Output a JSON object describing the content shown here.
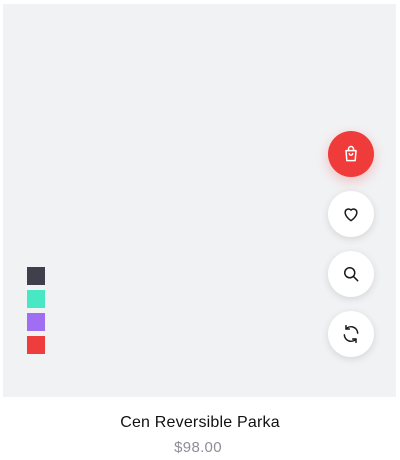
{
  "product": {
    "title": "Cen Reversible Parka",
    "price": "$98.00"
  },
  "swatches": [
    {
      "color": "#403f4c",
      "name": "dark-gray"
    },
    {
      "color": "#48e8c4",
      "name": "turquoise"
    },
    {
      "color": "#9f6ef2",
      "name": "purple"
    },
    {
      "color": "#ef3d3d",
      "name": "red"
    }
  ],
  "actions": [
    {
      "icon": "shopping-bag-icon",
      "accent": "#f03b3b"
    },
    {
      "icon": "heart-icon"
    },
    {
      "icon": "search-icon"
    },
    {
      "icon": "refresh-icon"
    }
  ]
}
